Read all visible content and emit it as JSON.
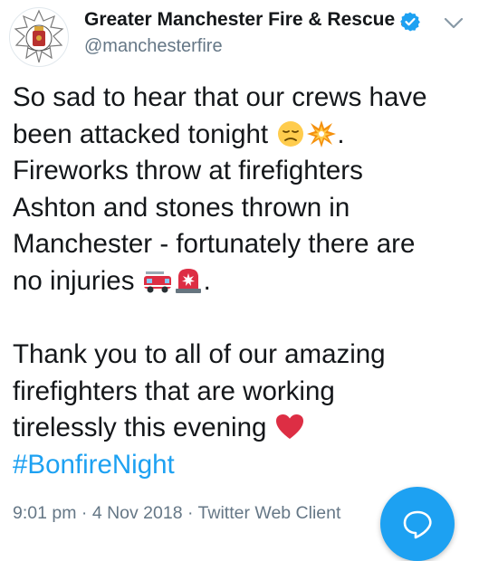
{
  "author": {
    "display_name": "Greater Manchester Fire & Rescue ...",
    "handle": "@manchesterfire",
    "verified": true,
    "avatar_icon": "fire-service-crest-icon"
  },
  "tweet": {
    "lines": [
      "So sad to hear that our crews have",
      "been attacked tonight",
      "Fireworks throw at firefighters",
      "Ashton and stones thrown in",
      "Manchester - fortunately there are",
      "no injuries",
      "Thank you to all of our amazing",
      "firefighters that are working",
      "tirelessly this evening"
    ],
    "hashtag": "#BonfireNight",
    "period": "."
  },
  "meta": {
    "time": "9:01 pm",
    "date": "4 Nov 2018",
    "client": "Twitter Web Client",
    "separator": " · "
  },
  "icons": {
    "verified": "verified-badge-icon",
    "menu": "chevron-down-icon",
    "fab": "reply-bubble-icon"
  },
  "colors": {
    "accent": "#1da1f2",
    "text": "#14171a",
    "secondary": "#657786"
  }
}
